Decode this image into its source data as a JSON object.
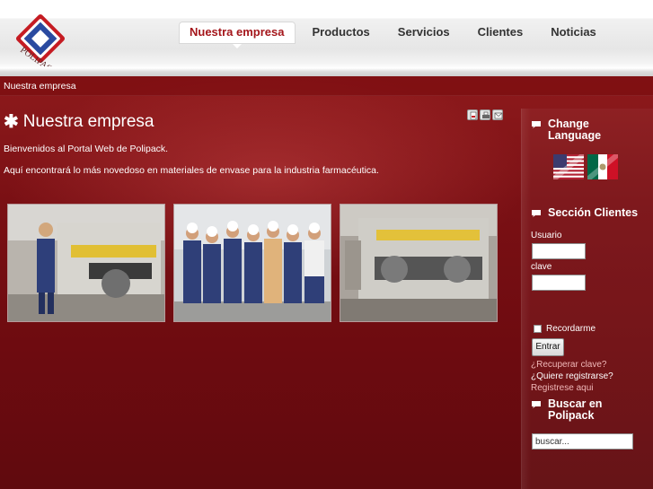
{
  "header": {
    "logo_text": "POLIPACK",
    "nav": [
      {
        "label": "Nuestra empresa",
        "active": true
      },
      {
        "label": "Productos",
        "active": false
      },
      {
        "label": "Servicios",
        "active": false
      },
      {
        "label": "Clientes",
        "active": false
      },
      {
        "label": "Noticias",
        "active": false
      }
    ]
  },
  "breadcrumb": "Nuestra empresa",
  "content": {
    "title": "Nuestra empresa",
    "title_icon": "asterisk-icon",
    "tools": [
      "pdf-icon",
      "print-icon",
      "email-icon"
    ],
    "paragraphs": [
      "Bienvenidos al Portal Web de Polipack.",
      "Aquí encontrará lo más novedoso en materiales de envase para la industria farmacéutica."
    ],
    "photos": [
      "machine-with-operator-photo",
      "team-group-photo",
      "machine-photo"
    ]
  },
  "sidebar": {
    "language": {
      "title_line1": "Change",
      "title_line2": "Language",
      "flags": [
        "usa-flag-icon",
        "mexico-flag-icon"
      ]
    },
    "clients": {
      "title": "Sección Clientes",
      "username_label": "Usuario",
      "username_value": "",
      "password_label": "clave",
      "password_value": "",
      "remember_label": "Recordarme",
      "remember_checked": false,
      "submit_label": "Entrar",
      "forgot_link": "¿Recuperar clave?",
      "register_question": "¿Quiere registrarse?",
      "register_link": "Registrese aqui"
    },
    "search": {
      "title_line1": "Buscar en",
      "title_line2": "Polipack",
      "placeholder": "buscar..."
    }
  },
  "colors": {
    "brand_red": "#a4161b",
    "background_red": "#7a1014",
    "link_pink": "#f0b8b8"
  }
}
